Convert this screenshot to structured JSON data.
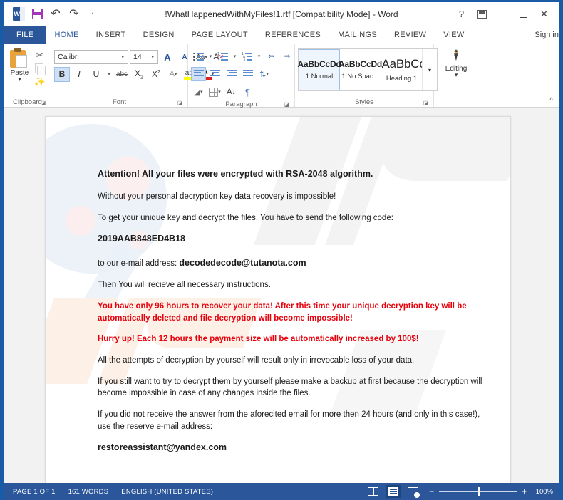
{
  "window": {
    "title": "!WhatHappenedWithMyFiles!1.rtf [Compatibility Mode] - Word",
    "quick_access": [
      {
        "name": "word-logo",
        "label": "W"
      },
      {
        "name": "save",
        "label": "Save"
      },
      {
        "name": "undo",
        "label": "↺"
      },
      {
        "name": "redo",
        "label": "↻"
      },
      {
        "name": "customize",
        "label": "▾"
      }
    ],
    "controls": {
      "help": "?",
      "ribbon_display_options": "Ribbon Display Options",
      "minimize": "Minimize",
      "maximize": "Maximize",
      "close": "✕"
    }
  },
  "tabs": {
    "file": "FILE",
    "items": [
      {
        "label": "HOME",
        "active": true
      },
      {
        "label": "INSERT",
        "active": false
      },
      {
        "label": "DESIGN",
        "active": false
      },
      {
        "label": "PAGE LAYOUT",
        "active": false
      },
      {
        "label": "REFERENCES",
        "active": false
      },
      {
        "label": "MAILINGS",
        "active": false
      },
      {
        "label": "REVIEW",
        "active": false
      },
      {
        "label": "VIEW",
        "active": false
      }
    ],
    "sign_in": "Sign in"
  },
  "ribbon": {
    "clipboard": {
      "label": "Clipboard",
      "paste": "Paste",
      "paste_arrow": "▾",
      "cut": "Cut",
      "copy": "Copy",
      "format_painter": "Format Painter",
      "dialog_launcher": "◪"
    },
    "font": {
      "label": "Font",
      "font_name": "Calibri",
      "font_size": "14",
      "arrow": "▾",
      "grow_font": "A",
      "shrink_font": "A",
      "change_case": "Aa",
      "clear_formatting": "A",
      "bold": "B",
      "italic": "I",
      "underline": "U",
      "strikethrough": "abc",
      "subscript": "X",
      "superscript": "X",
      "text_effects": "A",
      "highlight": "ab",
      "font_color": "A",
      "dialog_launcher": "◪"
    },
    "paragraph": {
      "label": "Paragraph",
      "bullets": "Bullets",
      "numbering": "Numbering",
      "multilevel_list": "Multilevel List",
      "decrease_indent": "Decrease Indent",
      "increase_indent": "Increase Indent",
      "align_left": "Align Left",
      "center": "Center",
      "align_right": "Align Right",
      "justify": "Justify",
      "line_spacing": "Line and Paragraph Spacing",
      "shading": "Shading",
      "borders": "Borders",
      "sort": "Sort",
      "show_marks": "¶",
      "dialog_launcher": "◪"
    },
    "styles": {
      "label": "Styles",
      "gallery": [
        {
          "preview": "AaBbCcDd",
          "name": "1 Normal",
          "selected": true
        },
        {
          "preview": "AaBbCcDd",
          "name": "1 No Spac...",
          "selected": false
        },
        {
          "preview": "AaBbCc",
          "name": "Heading 1",
          "selected": false
        }
      ],
      "more": "▾",
      "dialog_launcher": "◪"
    },
    "editing": {
      "label": "Editing",
      "arrow": "▾",
      "icon": "binoculars-icon"
    },
    "collapse": "^"
  },
  "document": {
    "paragraphs": [
      {
        "style": "head",
        "text": "Attention! All your files were encrypted with RSA-2048 algorithm."
      },
      {
        "style": "normal",
        "text": "Without your personal decryption key data recovery is impossible!"
      },
      {
        "style": "normal",
        "text": "To get your unique key and decrypt the files, You have to send the following code:"
      },
      {
        "style": "code",
        "text": "2019AAB848ED4B18"
      },
      {
        "style": "inline-mixed",
        "prefix": "to our e-mail address: ",
        "strong": "decodedecode@tutanota.com"
      },
      {
        "style": "normal",
        "text": "Then You will recieve all necessary instructions."
      },
      {
        "style": "red",
        "text": "You have only 96 hours to recover your data! After this time your unique decryption key will be automatically deleted and file decryption will become impossible!"
      },
      {
        "style": "red",
        "text": "Hurry up! Each 12 hours the payment size will be automatically increased by 100$!"
      },
      {
        "style": "normal",
        "text": "All the attempts of decryption by yourself will result only in irrevocable loss of your data."
      },
      {
        "style": "normal",
        "text": "If you still want to try to decrypt them by yourself please make a backup at first because the decryption will become impossible in case of any changes inside the files."
      },
      {
        "style": "normal",
        "text": "If you did not receive the answer from the aforecited email for more then 24 hours (and only in this case!), use the reserve e-mail address:"
      },
      {
        "style": "mail",
        "text": "restoreassistant@yandex.com"
      }
    ]
  },
  "statusbar": {
    "page": "PAGE 1 OF 1",
    "words": "161 WORDS",
    "language": "ENGLISH (UNITED STATES)",
    "views": [
      {
        "name": "read-mode",
        "active": false
      },
      {
        "name": "print-layout",
        "active": true
      },
      {
        "name": "web-layout",
        "active": false
      }
    ],
    "zoom_out": "−",
    "zoom_in": "+",
    "zoom_level": "100%"
  },
  "colors": {
    "word_blue": "#2b579a",
    "frame_blue": "#1a5ba6",
    "alert_red": "#e8000b",
    "ribbon_bg": "#ffffff",
    "doc_bg": "#f2f2f2"
  }
}
